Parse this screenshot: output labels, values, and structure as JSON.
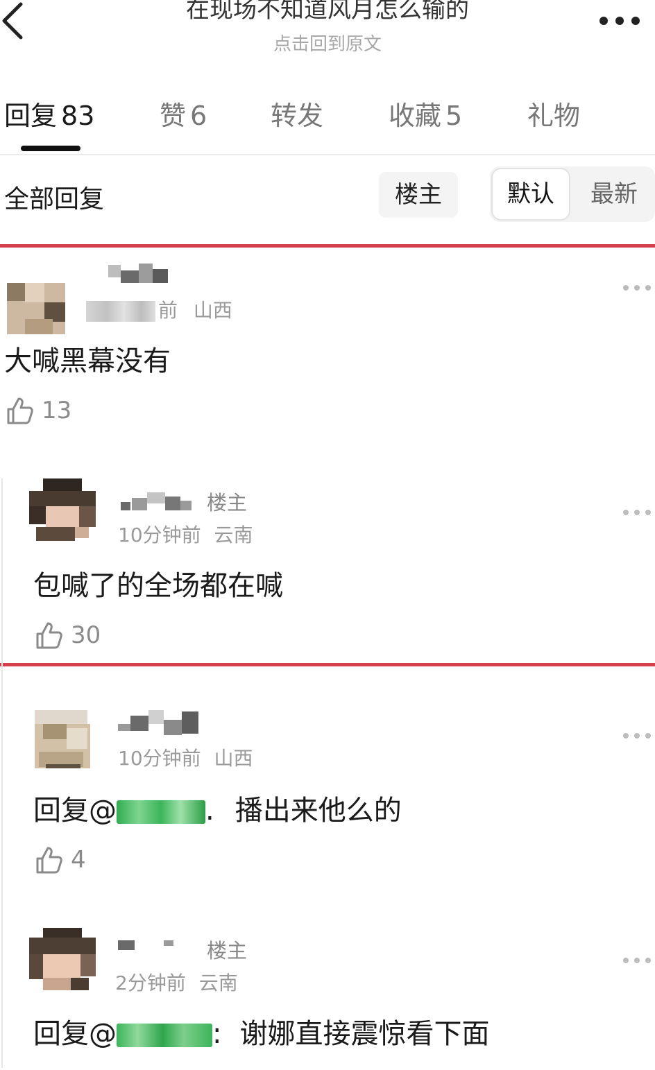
{
  "header": {
    "title": "在现场不知道风月怎么输的",
    "subtitle": "点击回到原文"
  },
  "tabs": [
    {
      "label": "回复",
      "count": "83",
      "active": true
    },
    {
      "label": "赞",
      "count": "6",
      "active": false
    },
    {
      "label": "转发",
      "count": "",
      "active": false
    },
    {
      "label": "收藏",
      "count": "5",
      "active": false
    },
    {
      "label": "礼物",
      "count": "",
      "active": false
    }
  ],
  "filter": {
    "label": "全部回复",
    "op_button": "楼主",
    "sort_options": [
      "默认",
      "最新"
    ],
    "sort_selected": "默认"
  },
  "comments": [
    {
      "time": "前",
      "location": "山西",
      "text": "大喊黑幕没有",
      "likes": "13",
      "is_op": false
    },
    {
      "op_label": "楼主",
      "time": "10分钟前",
      "location": "云南",
      "text": "包喊了的全场都在喊",
      "likes": "30",
      "is_op": true
    },
    {
      "time": "10分钟前",
      "location": "山西",
      "reply_prefix": "回复@",
      "reply_sep": ".",
      "text": "播出来他么的",
      "likes": "4",
      "is_op": false
    },
    {
      "op_label": "楼主",
      "time": "2分钟前",
      "location": "云南",
      "reply_prefix": "回复@",
      "reply_sep": ":",
      "text": "谢娜直接震惊看下面",
      "is_op": true
    }
  ],
  "icons": {
    "back": "chevron-left-icon",
    "more": "more-horizontal-icon",
    "like": "thumbs-up-icon",
    "comment_more": "more-dots-icon"
  },
  "colors": {
    "annotation_red": "#d6404c",
    "mention_green": "#3bb55a",
    "tab_active": "#1a1a1a",
    "tab_inactive": "#777777",
    "meta_gray": "#9a9a9a"
  }
}
